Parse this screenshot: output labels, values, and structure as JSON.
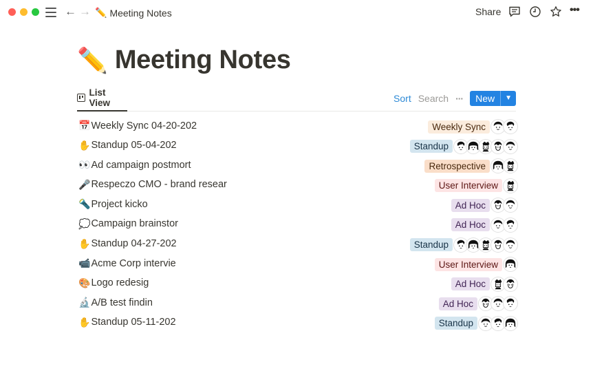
{
  "window": {
    "breadcrumb_emoji": "✏️",
    "breadcrumb_title": "Meeting Notes",
    "share_label": "Share",
    "more_label": "•••"
  },
  "page": {
    "emoji": "✏️",
    "title": "Meeting Notes"
  },
  "view": {
    "tab_label": "List View",
    "sort_label": "Sort",
    "search_label": "Search",
    "more_label": "···",
    "new_label": "New",
    "new_caret": "⌄"
  },
  "tag_colors": {
    "Weekly Sync": {
      "bg": "#fbecdd",
      "fg": "#49290e"
    },
    "Standup": {
      "bg": "#d3e5ef",
      "fg": "#183347"
    },
    "Retrospective": {
      "bg": "#fbe4e4",
      "fg": "#5d1715"
    },
    "User Interview": {
      "bg": "#fde4e4",
      "fg": "#5d1715"
    },
    "Ad Hoc": {
      "bg": "#e8deee",
      "fg": "#412454"
    }
  },
  "rows": [
    {
      "emoji": "📅",
      "title": "Weekly Sync 04-20-202",
      "tag": "Weekly Sync",
      "tag_bg": "#fbecdd",
      "tag_fg": "#49290e",
      "avatars": 2
    },
    {
      "emoji": "✋",
      "title": "Standup 05-04-202",
      "tag": "Standup",
      "tag_bg": "#d3e5ef",
      "tag_fg": "#183347",
      "avatars": 5
    },
    {
      "emoji": "👀",
      "title": "Ad campaign postmort",
      "tag": "Retrospective",
      "tag_bg": "#fadec9",
      "tag_fg": "#49290e",
      "avatars": 2
    },
    {
      "emoji": "🎤",
      "title": "Respeczo CMO - brand resear",
      "tag": "User Interview",
      "tag_bg": "#fde4e4",
      "tag_fg": "#5d1715",
      "avatars": 1
    },
    {
      "emoji": "🔦",
      "title": "Project kicko",
      "tag": "Ad Hoc",
      "tag_bg": "#e8deee",
      "tag_fg": "#412454",
      "avatars": 2
    },
    {
      "emoji": "💭",
      "title": "Campaign brainstor",
      "tag": "Ad Hoc",
      "tag_bg": "#e8deee",
      "tag_fg": "#412454",
      "avatars": 2
    },
    {
      "emoji": "✋",
      "title": "Standup 04-27-202",
      "tag": "Standup",
      "tag_bg": "#d3e5ef",
      "tag_fg": "#183347",
      "avatars": 5
    },
    {
      "emoji": "📹",
      "title": "Acme Corp intervie",
      "tag": "User Interview",
      "tag_bg": "#fde4e4",
      "tag_fg": "#5d1715",
      "avatars": 1
    },
    {
      "emoji": "🎨",
      "title": "Logo redesig",
      "tag": "Ad Hoc",
      "tag_bg": "#e8deee",
      "tag_fg": "#412454",
      "avatars": 2
    },
    {
      "emoji": "🔬",
      "title": "A/B test findin",
      "tag": "Ad Hoc",
      "tag_bg": "#e8deee",
      "tag_fg": "#412454",
      "avatars": 3
    },
    {
      "emoji": "✋",
      "title": "Standup 05-11-202",
      "tag": "Standup",
      "tag_bg": "#d3e5ef",
      "tag_fg": "#183347",
      "avatars": 3
    }
  ]
}
